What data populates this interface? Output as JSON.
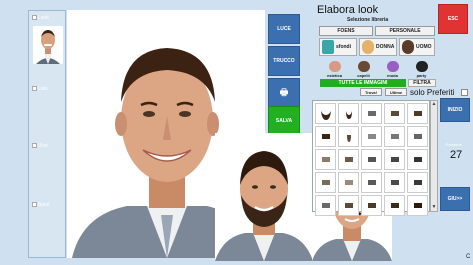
{
  "left_panel": {
    "slots": [
      {
        "label": "Look"
      },
      {
        "label": "Lato"
      },
      {
        "label": "Viso"
      },
      {
        "label": "Base"
      }
    ]
  },
  "tools": {
    "luce": "LUCE",
    "trucco": "TRUCCO",
    "print": "🖶",
    "salva": "SALVA"
  },
  "panel": {
    "title": "Elabora look",
    "library_title": "Selezione libreria",
    "esc": "ESC",
    "tabs": {
      "foens": "FOENS",
      "personale": "PERSONALE"
    },
    "categories": {
      "sfondi": "sfondi",
      "donna": "DONNA",
      "uomo": "UOMO"
    },
    "subcategories": [
      "estetica",
      "capelli",
      "moda",
      "party"
    ],
    "all_images": "TUTTE LE IMMAGINI",
    "filtra": "FILTRA",
    "trova": "Trova!",
    "ultime": "Ultime",
    "preferiti": "solo Preferiti",
    "inizio": "INIZIO",
    "count_label": "Elementi",
    "count": "27",
    "next": "GIU>>",
    "corner": "C"
  }
}
